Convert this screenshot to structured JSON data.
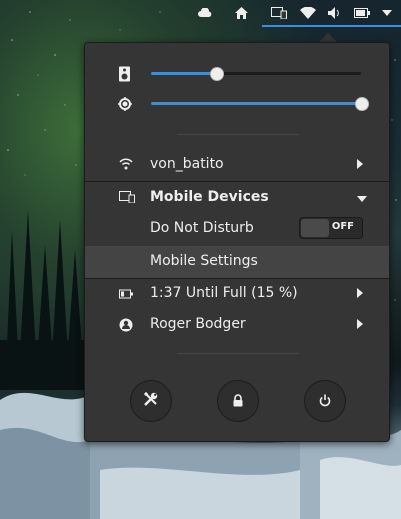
{
  "topbar": {
    "icons": [
      "cloud-icon",
      "home-icon",
      "mobile-devices-icon",
      "wifi-icon",
      "volume-icon",
      "battery-icon",
      "menu-arrow-icon"
    ]
  },
  "menu": {
    "sliders": [
      {
        "name": "volume",
        "icon": "speaker-icon",
        "level": 0.31
      },
      {
        "name": "brightness",
        "icon": "brightness-icon",
        "level": 1.0
      }
    ],
    "network": {
      "label": "von_batito",
      "icon": "wifi-icon"
    },
    "mobile_devices": {
      "label": "Mobile Devices",
      "icon": "mobile-devices-icon"
    },
    "do_not_disturb": {
      "label": "Do Not Disturb",
      "toggle_text": "OFF"
    },
    "mobile_settings": {
      "label": "Mobile Settings"
    },
    "battery": {
      "label": "1:37 Until Full (15 %)",
      "icon": "battery-icon"
    },
    "user": {
      "label": "Roger Bodger",
      "icon": "user-icon"
    },
    "actions": [
      {
        "name": "settings",
        "icon": "tools-icon"
      },
      {
        "name": "lock",
        "icon": "lock-icon"
      },
      {
        "name": "power",
        "icon": "power-icon"
      }
    ]
  },
  "colors": {
    "accent": "#3b8ed8",
    "popover_bg": "#353535",
    "highlight": "#444444",
    "text": "#eeeeec"
  }
}
